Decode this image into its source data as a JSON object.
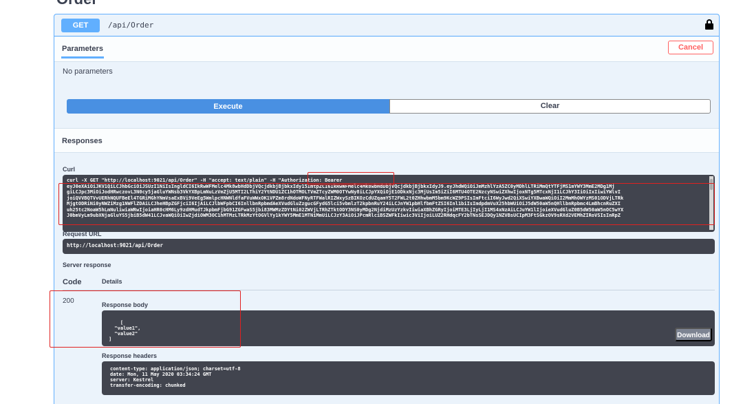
{
  "section": {
    "title": "Order",
    "chevron": "⌄"
  },
  "operation": {
    "method": "GET",
    "path": "/api/Order",
    "lock_icon": "lock-icon"
  },
  "parameters": {
    "title": "Parameters",
    "cancel_label": "Cancel",
    "empty_text": "No parameters"
  },
  "actions": {
    "execute_label": "Execute",
    "clear_label": "Clear"
  },
  "responses": {
    "title": "Responses",
    "curl_label": "Curl",
    "curl_text": "curl -X GET \"http://localhost:9021/api/Order\" -H \"accept: text/plain\" -H \"Authorization: Bearer\neyJ0eXAiOiJKV1QiLCJhbGciOiJSUzI1NiIsIngldCI6IkRwWFMelc4Mk8wbHdDbjVQcjdkbjBjbkxIdy15ImtpZCI6IkRwWFMelc4Mk8wbHdDbjVQcjdkbjBjbkxIdyJ9.eyJhdWQiOiJmMzhlYzA5ZC0yMDhlLTRiMmQtYTFjMS1mYWY3MmE2MDg1Mj\ngiLCJpc3MiOiJodHRwczovL3N0cy5jaGluYWNsb3VkYXBpLmNuLzVmZjU5MTI2LThiY2YtNDU1ZC1hOTMOLTVmZTcyZWM0OTYwNy8iLCJpYXQiOjE1ODkxNjc3MjUsIm5iZiI6MTU4OTE2NzcyNSwiZXhwIjoxNTg5MTcxNjI1LCJhY3IiOiIxIiwiYWlvI\njoiQVVBQTVvUERhNQUFBeEl4TGRiMGhYNmVsaExBVi9VeEg5WmlpcHNWNldfaFVuWWxOK1VPZm8rdNdoWFNyRTFWalRIZWxySzBIKOzCdUZqamY5T2FWL2t0ZHhwbmM5bm9KcWZ9PSIsImFtciI6WyJwd2QiXSwiYXBwaWQiOiI2MmMhOWYzMS01ODVjLTRk\nMjgtODRiNi0yNWZiMzg1NWFlZDAiLCJheHBpZGFjciI6IjAiLCJlbWFpbCI6InllbnRpbmdAeXVudGluZzgucGFydG5lci5vbmlzT2kpbnRuY24iLCJnYW1pbHlfbmFtZSI6Inl1biIsImdpdmVuX25hbWUiOiJ5dW50aW5nQHllbnRpbmc4LmBhcnRuZXI\nuh25tc2NoaW5hLmNuliwiaWRwIjoiaHR0cHM6Ly9zdHMudTJkpbmFjbG91ZGFwaS5jbi83MWMzZDYtNi02ZWVjLTRhZTktODY3NS0yMDg2NjdiMzUzYzkvIiwiaXBhZGRyIjoiMTE3LjIyLjI1MS4xNzAiLCJuYW1lIjoieXVudGluZ0B5dW50aW5nOC5wYX\nJ0bmVyLm9ubXNjaGluYS5jbiB5dW41LCJvaWQiOiIwZjdiOWM3OC1hMTMzLTRkMzYtOGVlYy1kYWY5MmE1MTNiMmUiLCJzY3AiOiJPcmRlciBSZWFkIiwic3ViIjoiLUZ2RHdqcFY2bTNsSEJDQy1NZVBsUCIpM3FtSGkzOV9sRXd2VEMhZIRoVSIsInRpZ",
    "request_url_label": "Request URL",
    "request_url": "http://localhost:9021/api/Order",
    "server_response_label": "Server response",
    "code_header": "Code",
    "details_header": "Details",
    "status_code": "200",
    "response_body_label": "Response body",
    "response_body": "[\n  \"value1\",\n  \"value2\"\n]",
    "download_label": "Download",
    "response_headers_label": "Response headers",
    "response_headers": "content-type: application/json; charset=utf-8\ndate: Mon, 11 May 2020 03:34:24 GMT\nserver: Kestrel\ntransfer-encoding: chunked"
  },
  "colors": {
    "get": "#61affe",
    "execute": "#4990e2",
    "cancel": "#ff6060",
    "highlight": "#e02020",
    "code_bg": "#41444e"
  }
}
